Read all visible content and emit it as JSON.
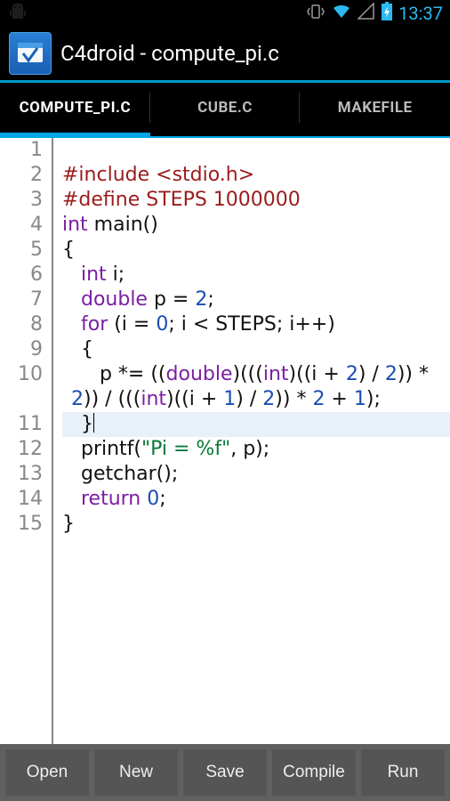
{
  "status": {
    "time": "13:37"
  },
  "app": {
    "title": "C4droid - compute_pi.c"
  },
  "tabs": [
    {
      "label": "COMPUTE_PI.C",
      "active": true
    },
    {
      "label": "CUBE.C",
      "active": false
    },
    {
      "label": "MAKEFILE",
      "active": false
    }
  ],
  "code": {
    "line_count": 15,
    "highlight_line": 11,
    "lines": [
      [],
      [
        {
          "cls": "t-pre",
          "txt": "#include <stdio.h>"
        }
      ],
      [
        {
          "cls": "t-pre",
          "txt": "#define STEPS 1000000"
        }
      ],
      [
        {
          "cls": "t-kw",
          "txt": "int"
        },
        {
          "cls": "t-plain",
          "txt": " main()"
        }
      ],
      [
        {
          "cls": "t-plain",
          "txt": "{"
        }
      ],
      [
        {
          "cls": "t-plain",
          "txt": "   "
        },
        {
          "cls": "t-kw",
          "txt": "int"
        },
        {
          "cls": "t-plain",
          "txt": " i;"
        }
      ],
      [
        {
          "cls": "t-plain",
          "txt": "   "
        },
        {
          "cls": "t-kw",
          "txt": "double"
        },
        {
          "cls": "t-plain",
          "txt": " p = "
        },
        {
          "cls": "t-num",
          "txt": "2"
        },
        {
          "cls": "t-plain",
          "txt": ";"
        }
      ],
      [
        {
          "cls": "t-plain",
          "txt": "   "
        },
        {
          "cls": "t-kw",
          "txt": "for"
        },
        {
          "cls": "t-plain",
          "txt": " (i = "
        },
        {
          "cls": "t-num",
          "txt": "0"
        },
        {
          "cls": "t-plain",
          "txt": "; i < STEPS; i++)"
        }
      ],
      [
        {
          "cls": "t-plain",
          "txt": "   {"
        }
      ],
      [
        {
          "cls": "t-plain",
          "txt": "      p *= (("
        },
        {
          "cls": "t-kw",
          "txt": "double"
        },
        {
          "cls": "t-plain",
          "txt": ")((("
        },
        {
          "cls": "t-kw",
          "txt": "int"
        },
        {
          "cls": "t-plain",
          "txt": ")((i + "
        },
        {
          "cls": "t-num",
          "txt": "2"
        },
        {
          "cls": "t-plain",
          "txt": ") / "
        },
        {
          "cls": "t-num",
          "txt": "2"
        },
        {
          "cls": "t-plain",
          "txt": ")) * "
        },
        {
          "cls": "t-num",
          "txt": "2"
        },
        {
          "cls": "t-plain",
          "txt": ")) / ((("
        },
        {
          "cls": "t-kw",
          "txt": "int"
        },
        {
          "cls": "t-plain",
          "txt": ")((i + "
        },
        {
          "cls": "t-num",
          "txt": "1"
        },
        {
          "cls": "t-plain",
          "txt": ") / "
        },
        {
          "cls": "t-num",
          "txt": "2"
        },
        {
          "cls": "t-plain",
          "txt": ")) * "
        },
        {
          "cls": "t-num",
          "txt": "2"
        },
        {
          "cls": "t-plain",
          "txt": " + "
        },
        {
          "cls": "t-num",
          "txt": "1"
        },
        {
          "cls": "t-plain",
          "txt": ");"
        }
      ],
      [
        {
          "cls": "t-plain",
          "txt": "   }"
        }
      ],
      [
        {
          "cls": "t-plain",
          "txt": "   printf("
        },
        {
          "cls": "t-str",
          "txt": "\"Pi = %f\""
        },
        {
          "cls": "t-plain",
          "txt": ", p);"
        }
      ],
      [
        {
          "cls": "t-plain",
          "txt": "   getchar();"
        }
      ],
      [
        {
          "cls": "t-plain",
          "txt": "   "
        },
        {
          "cls": "t-kw",
          "txt": "return"
        },
        {
          "cls": "t-plain",
          "txt": " "
        },
        {
          "cls": "t-num",
          "txt": "0"
        },
        {
          "cls": "t-plain",
          "txt": ";"
        }
      ],
      [
        {
          "cls": "t-plain",
          "txt": "}"
        }
      ]
    ]
  },
  "toolbar": {
    "buttons": [
      "Open",
      "New",
      "Save",
      "Compile",
      "Run"
    ]
  }
}
